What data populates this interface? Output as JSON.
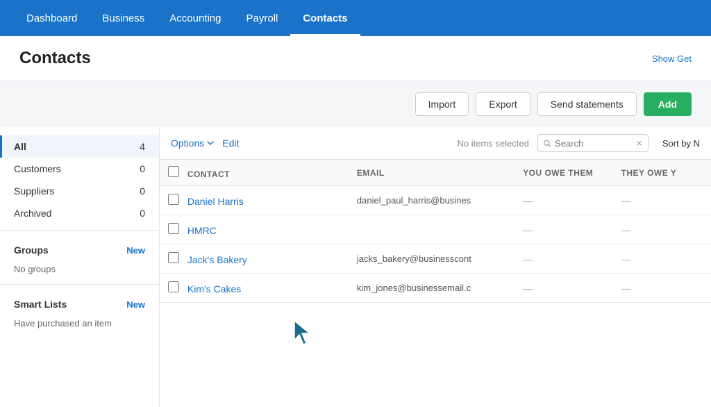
{
  "nav": {
    "items": [
      {
        "label": "Dashboard",
        "active": false
      },
      {
        "label": "Business",
        "active": false
      },
      {
        "label": "Accounting",
        "active": false
      },
      {
        "label": "Payroll",
        "active": false
      },
      {
        "label": "Contacts",
        "active": true
      }
    ]
  },
  "page": {
    "title": "Contacts",
    "show_get": "Show Get"
  },
  "toolbar": {
    "import_label": "Import",
    "export_label": "Export",
    "send_statements_label": "Send statements",
    "add_label": "Add"
  },
  "sidebar": {
    "all_label": "All",
    "all_count": "4",
    "customers_label": "Customers",
    "customers_count": "0",
    "suppliers_label": "Suppliers",
    "suppliers_count": "0",
    "archived_label": "Archived",
    "archived_count": "0",
    "groups_label": "Groups",
    "groups_new": "New",
    "no_groups_label": "No groups",
    "smart_lists_label": "Smart Lists",
    "smart_lists_new": "New",
    "purchased_label": "Have purchased an item"
  },
  "content_toolbar": {
    "options_label": "Options",
    "edit_label": "Edit",
    "no_items_label": "No items selected",
    "search_placeholder": "Search",
    "sort_label": "Sort by N"
  },
  "table": {
    "columns": [
      {
        "key": "contact",
        "label": "CONTACT"
      },
      {
        "key": "email",
        "label": "EMAIL"
      },
      {
        "key": "you_owe",
        "label": "YOU OWE THEM"
      },
      {
        "key": "they_owe",
        "label": "THEY OWE Y"
      }
    ],
    "rows": [
      {
        "name": "Daniel Harris",
        "email": "daniel_paul_harris@busines",
        "you_owe": "—",
        "they_owe": "—"
      },
      {
        "name": "HMRC",
        "email": "",
        "you_owe": "—",
        "they_owe": "—"
      },
      {
        "name": "Jack's Bakery",
        "email": "jacks_bakery@businesscont",
        "you_owe": "—",
        "they_owe": "—"
      },
      {
        "name": "Kim's Cakes",
        "email": "kim_jones@businessemail.c",
        "you_owe": "—",
        "they_owe": "—"
      }
    ]
  },
  "colors": {
    "nav_bg": "#1a73c8",
    "active_border": "#1a73c8",
    "link": "#1a73c8",
    "add_btn": "#27ae60"
  }
}
